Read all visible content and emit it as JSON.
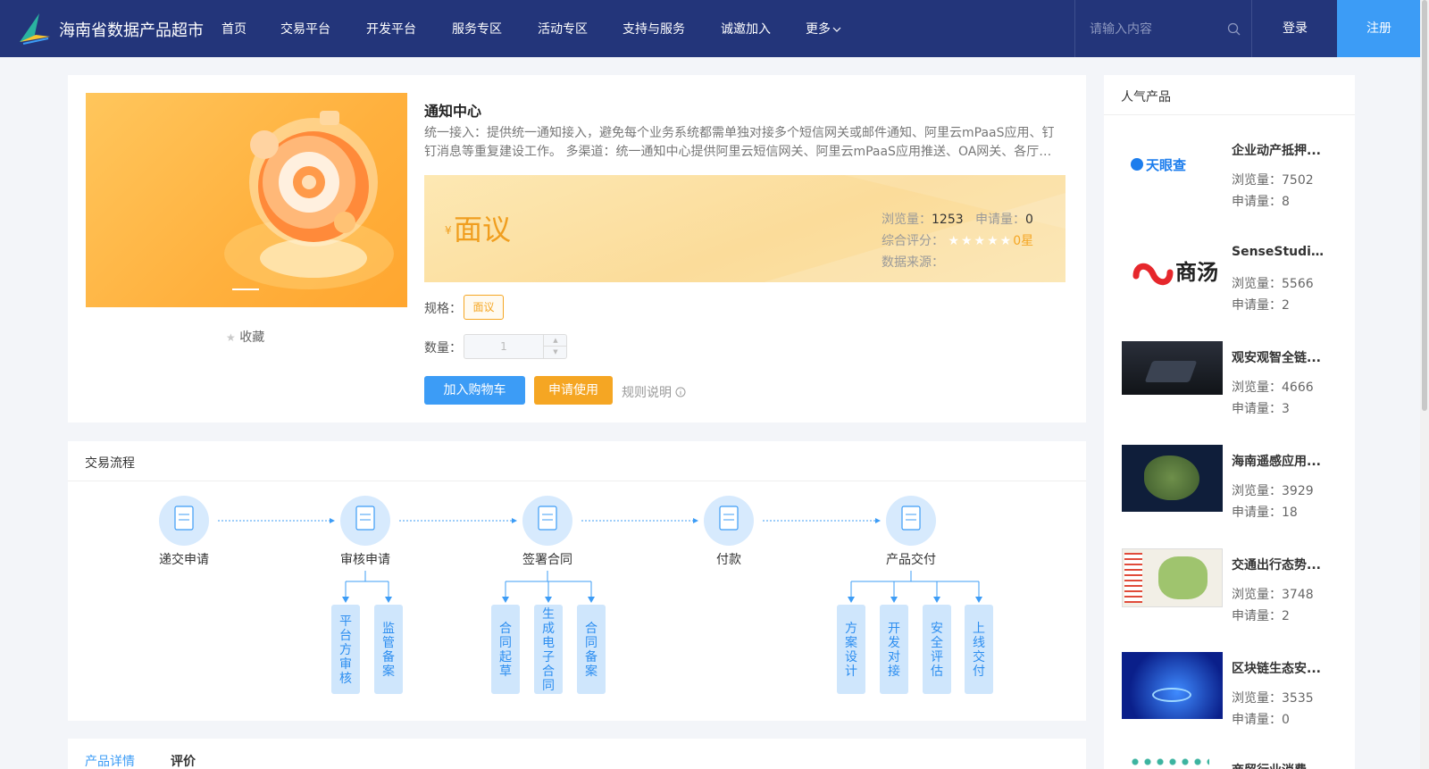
{
  "header": {
    "site_name": "海南省数据产品超市",
    "menu": [
      {
        "label": "首页",
        "name": "nav-home"
      },
      {
        "label": "交易平台",
        "name": "nav-trade"
      },
      {
        "label": "开发平台",
        "name": "nav-dev"
      },
      {
        "label": "服务专区",
        "name": "nav-service"
      },
      {
        "label": "活动专区",
        "name": "nav-activity"
      },
      {
        "label": "支持与服务",
        "name": "nav-support"
      },
      {
        "label": "诚邀加入",
        "name": "nav-join"
      },
      {
        "label": "更多",
        "name": "nav-more"
      }
    ],
    "search_placeholder": "请输入内容",
    "login": "登录",
    "register": "注册"
  },
  "product": {
    "title": "通知中心",
    "description": "统一接入：提供统一通知接入，避免每个业务系统都需单独对接多个短信网关或邮件通知、阿里云mPaaS应用、钉钉消息等重复建设工作。 多渠道：统一通知中心提供阿里云短信网关、阿里云mPaaS应用推送、OA网关、各厅…",
    "favorite": "收藏",
    "currency": "¥",
    "price": "面议",
    "views_label": "浏览量：",
    "views": "1253",
    "applies_label": "申请量：",
    "applies": "0",
    "rating_label": "综合评分：",
    "rating": "0星",
    "source_label": "数据来源：",
    "source": "",
    "spec_label": "规格：",
    "spec": "面议",
    "qty_label": "数量：",
    "qty": "1",
    "add_cart": "加入购物车",
    "apply": "申请使用",
    "rules": "规则说明"
  },
  "process": {
    "title": "交易流程",
    "steps": [
      {
        "label": "递交申请",
        "subs": []
      },
      {
        "label": "审核申请",
        "subs": [
          "平台方审核",
          "监管备案"
        ]
      },
      {
        "label": "签署合同",
        "subs": [
          "合同起草",
          "生成电子合同",
          "合同备案"
        ]
      },
      {
        "label": "付款",
        "subs": []
      },
      {
        "label": "产品交付",
        "subs": [
          "方案设计",
          "开发对接",
          "安全评估",
          "上线交付"
        ]
      }
    ]
  },
  "tabs": {
    "detail": "产品详情",
    "review": "评价"
  },
  "sidebar": {
    "title": "人气产品",
    "views_label": "浏览量：",
    "applies_label": "申请量：",
    "items": [
      {
        "name": "企业动产抵押...",
        "views": "7502",
        "applies": "8",
        "logo_text": "天眼查"
      },
      {
        "name": "SenseStudio...",
        "views": "5566",
        "applies": "2",
        "logo_text": "商汤"
      },
      {
        "name": "观安观智全链...",
        "views": "4666",
        "applies": "3"
      },
      {
        "name": "海南遥感应用...",
        "views": "3929",
        "applies": "18"
      },
      {
        "name": "交通出行态势...",
        "views": "3748",
        "applies": "2"
      },
      {
        "name": "区块链生态安...",
        "views": "3535",
        "applies": "0"
      },
      {
        "name": "商贸行业消费...",
        "views": "",
        "applies": ""
      }
    ]
  },
  "colors": {
    "nav": "#23357a",
    "primary": "#3c9cf6",
    "accent": "#f5a623"
  }
}
